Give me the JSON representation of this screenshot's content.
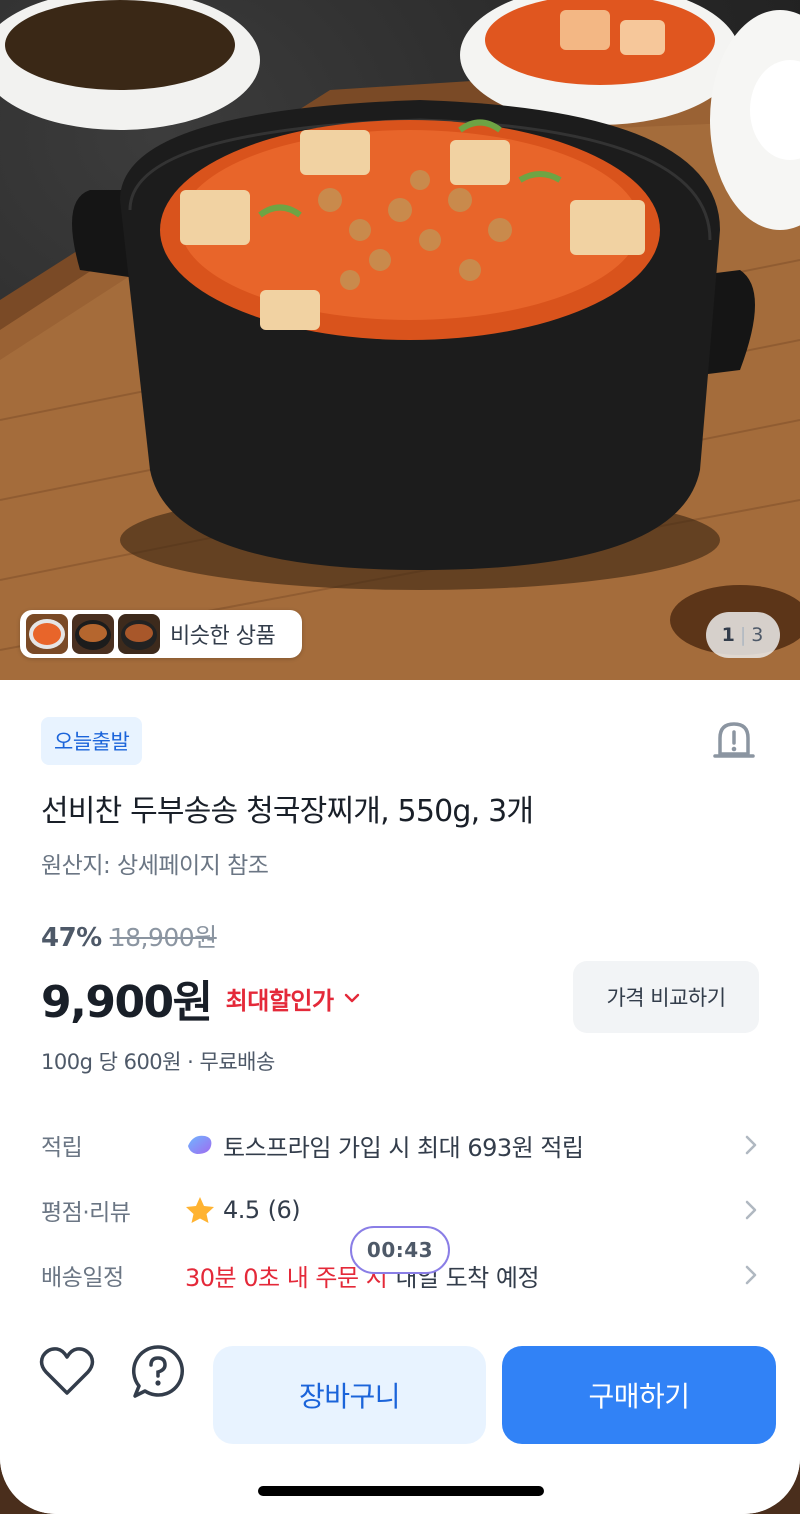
{
  "gallery": {
    "similar_label": "비슷한 상품",
    "page_current": "1",
    "page_total": "3"
  },
  "product": {
    "badge": "오늘출발",
    "title": "선비찬 두부송송 청국장찌개, 550g, 3개",
    "origin": "원산지: 상세페이지 참조",
    "discount_rate": "47%",
    "original_price": "18,900원",
    "price": "9,900원",
    "max_discount_label": "최대할인가",
    "compare_button": "가격 비교하기",
    "unit_info": "100g 당 600원 · 무료배송"
  },
  "info": {
    "points": {
      "label": "적립",
      "value": "토스프라임 가입 시 최대 693원 적립"
    },
    "rating": {
      "label": "평점·리뷰",
      "score": "4.5",
      "count": "(6)"
    },
    "delivery": {
      "label": "배송일정",
      "countdown": "30분 0초 내 주문 시",
      "value": "내일 도착 예정"
    }
  },
  "timer": "00:43",
  "actions": {
    "cart": "장바구니",
    "buy": "구매하기"
  },
  "colors": {
    "primary": "#3182f6",
    "primary_light": "#e8f3ff",
    "discount_red": "#e42939",
    "star": "#ffb331"
  }
}
